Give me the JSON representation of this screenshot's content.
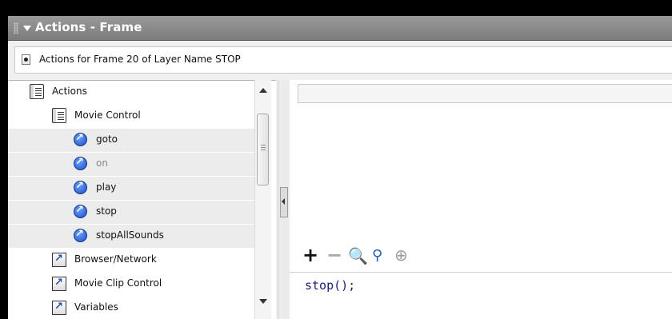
{
  "panel": {
    "title": "Actions - Frame"
  },
  "info": {
    "text": "Actions for Frame 20 of Layer Name STOP"
  },
  "tree": {
    "items": [
      {
        "label": "Actions",
        "icon": "book-icon",
        "dim": false
      },
      {
        "label": "Movie Control",
        "icon": "book-icon",
        "dim": false
      },
      {
        "label": "goto",
        "icon": "action-circle-icon",
        "dim": false
      },
      {
        "label": "on",
        "icon": "action-circle-icon",
        "dim": true
      },
      {
        "label": "play",
        "icon": "action-circle-icon",
        "dim": false
      },
      {
        "label": "stop",
        "icon": "action-circle-icon",
        "dim": false
      },
      {
        "label": "stopAllSounds",
        "icon": "action-circle-icon",
        "dim": false
      },
      {
        "label": "Browser/Network",
        "icon": "category-arrow-icon",
        "dim": false
      },
      {
        "label": "Movie Clip Control",
        "icon": "category-arrow-icon",
        "dim": false
      },
      {
        "label": "Variables",
        "icon": "category-arrow-icon",
        "dim": false
      }
    ]
  },
  "toolbar": {
    "add": "+",
    "remove": "−",
    "find": "🔍",
    "replace": "⚲",
    "target": "⊕"
  },
  "script": {
    "code": "stop();"
  },
  "colors": {
    "title_bg": "#868686",
    "code_text": "#1a1a8a",
    "icon_blue": "#1a4fc8"
  }
}
